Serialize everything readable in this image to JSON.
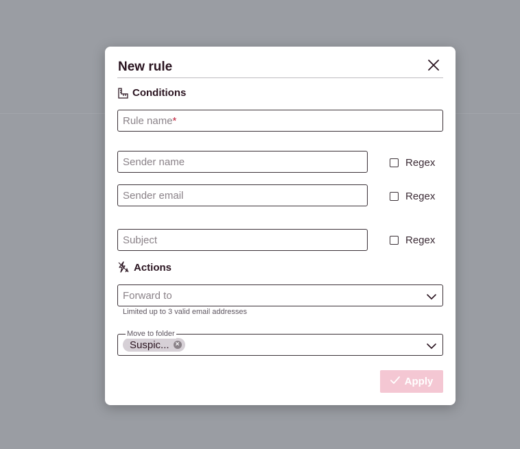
{
  "modal": {
    "title": "New rule",
    "close_icon": "close-icon"
  },
  "conditions": {
    "heading": "Conditions",
    "icon": "ruler-icon",
    "rule_name": {
      "placeholder": "Rule name",
      "required_mark": "*",
      "value": ""
    },
    "sender_name": {
      "placeholder": "Sender name",
      "value": "",
      "regex_label": "Regex",
      "regex_checked": false
    },
    "sender_email": {
      "placeholder": "Sender email",
      "value": "",
      "regex_label": "Regex",
      "regex_checked": false
    },
    "subject": {
      "placeholder": "Subject",
      "value": "",
      "regex_label": "Regex",
      "regex_checked": false
    }
  },
  "actions": {
    "heading": "Actions",
    "icon": "zap-icon",
    "forward_to": {
      "placeholder": "Forward to",
      "hint": "Limited up to 3 valid email addresses"
    },
    "move_to_folder": {
      "label": "Move to folder",
      "selected_chip": "Suspic..."
    }
  },
  "footer": {
    "apply_label": "Apply"
  },
  "colors": {
    "accent_disabled": "#f4c7d3",
    "required": "#c0203a",
    "backdrop": "#9a9da3"
  }
}
